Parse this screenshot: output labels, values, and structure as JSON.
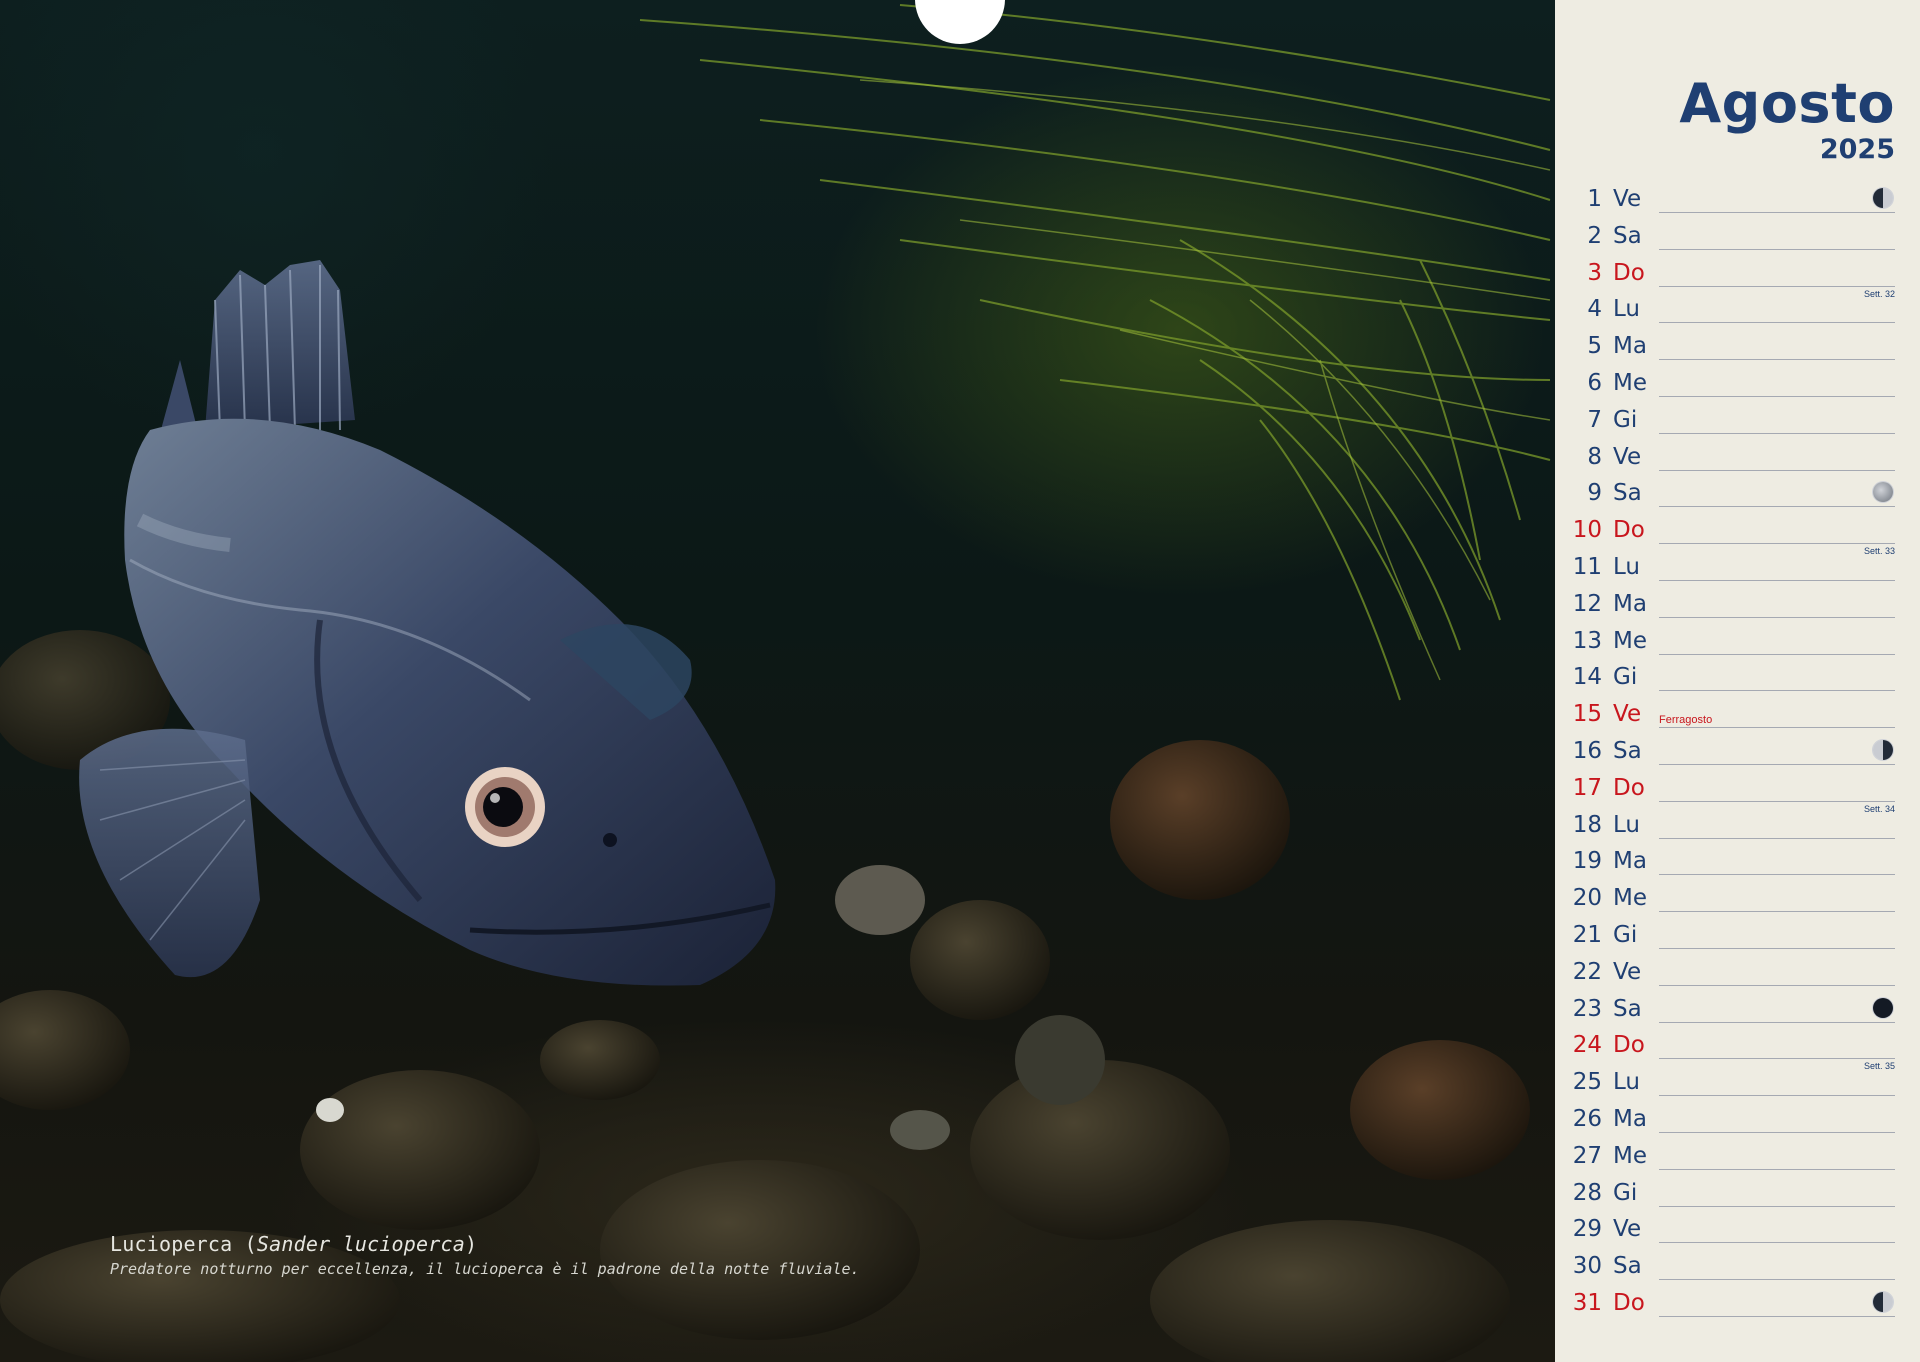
{
  "calendar": {
    "month": "Agosto",
    "year": "2025",
    "days": [
      {
        "num": "1",
        "name": "Ve",
        "moon": "first-quarter"
      },
      {
        "num": "2",
        "name": "Sa"
      },
      {
        "num": "3",
        "name": "Do",
        "sunday": true,
        "week": "Sett. 32"
      },
      {
        "num": "4",
        "name": "Lu"
      },
      {
        "num": "5",
        "name": "Ma"
      },
      {
        "num": "6",
        "name": "Me"
      },
      {
        "num": "7",
        "name": "Gi"
      },
      {
        "num": "8",
        "name": "Ve"
      },
      {
        "num": "9",
        "name": "Sa",
        "moon": "full"
      },
      {
        "num": "10",
        "name": "Do",
        "sunday": true,
        "week": "Sett. 33"
      },
      {
        "num": "11",
        "name": "Lu"
      },
      {
        "num": "12",
        "name": "Ma"
      },
      {
        "num": "13",
        "name": "Me"
      },
      {
        "num": "14",
        "name": "Gi"
      },
      {
        "num": "15",
        "name": "Ve",
        "holiday": "Ferragosto"
      },
      {
        "num": "16",
        "name": "Sa",
        "moon": "last-quarter"
      },
      {
        "num": "17",
        "name": "Do",
        "sunday": true,
        "week": "Sett. 34"
      },
      {
        "num": "18",
        "name": "Lu"
      },
      {
        "num": "19",
        "name": "Ma"
      },
      {
        "num": "20",
        "name": "Me"
      },
      {
        "num": "21",
        "name": "Gi"
      },
      {
        "num": "22",
        "name": "Ve"
      },
      {
        "num": "23",
        "name": "Sa",
        "moon": "new"
      },
      {
        "num": "24",
        "name": "Do",
        "sunday": true,
        "week": "Sett. 35"
      },
      {
        "num": "25",
        "name": "Lu"
      },
      {
        "num": "26",
        "name": "Ma"
      },
      {
        "num": "27",
        "name": "Me"
      },
      {
        "num": "28",
        "name": "Gi"
      },
      {
        "num": "29",
        "name": "Ve"
      },
      {
        "num": "30",
        "name": "Sa"
      },
      {
        "num": "31",
        "name": "Do",
        "sunday": true,
        "moon": "first-quarter"
      }
    ]
  },
  "photo": {
    "common_name": "Lucioperca",
    "scientific_name": "Sander lucioperca",
    "description": "Predatore notturno per eccellenza, il lucioperca è il padrone della notte fluviale."
  },
  "colors": {
    "accent_blue": "#1f3f72",
    "sunday_red": "#c8161d",
    "panel_background": "#eeece2"
  }
}
